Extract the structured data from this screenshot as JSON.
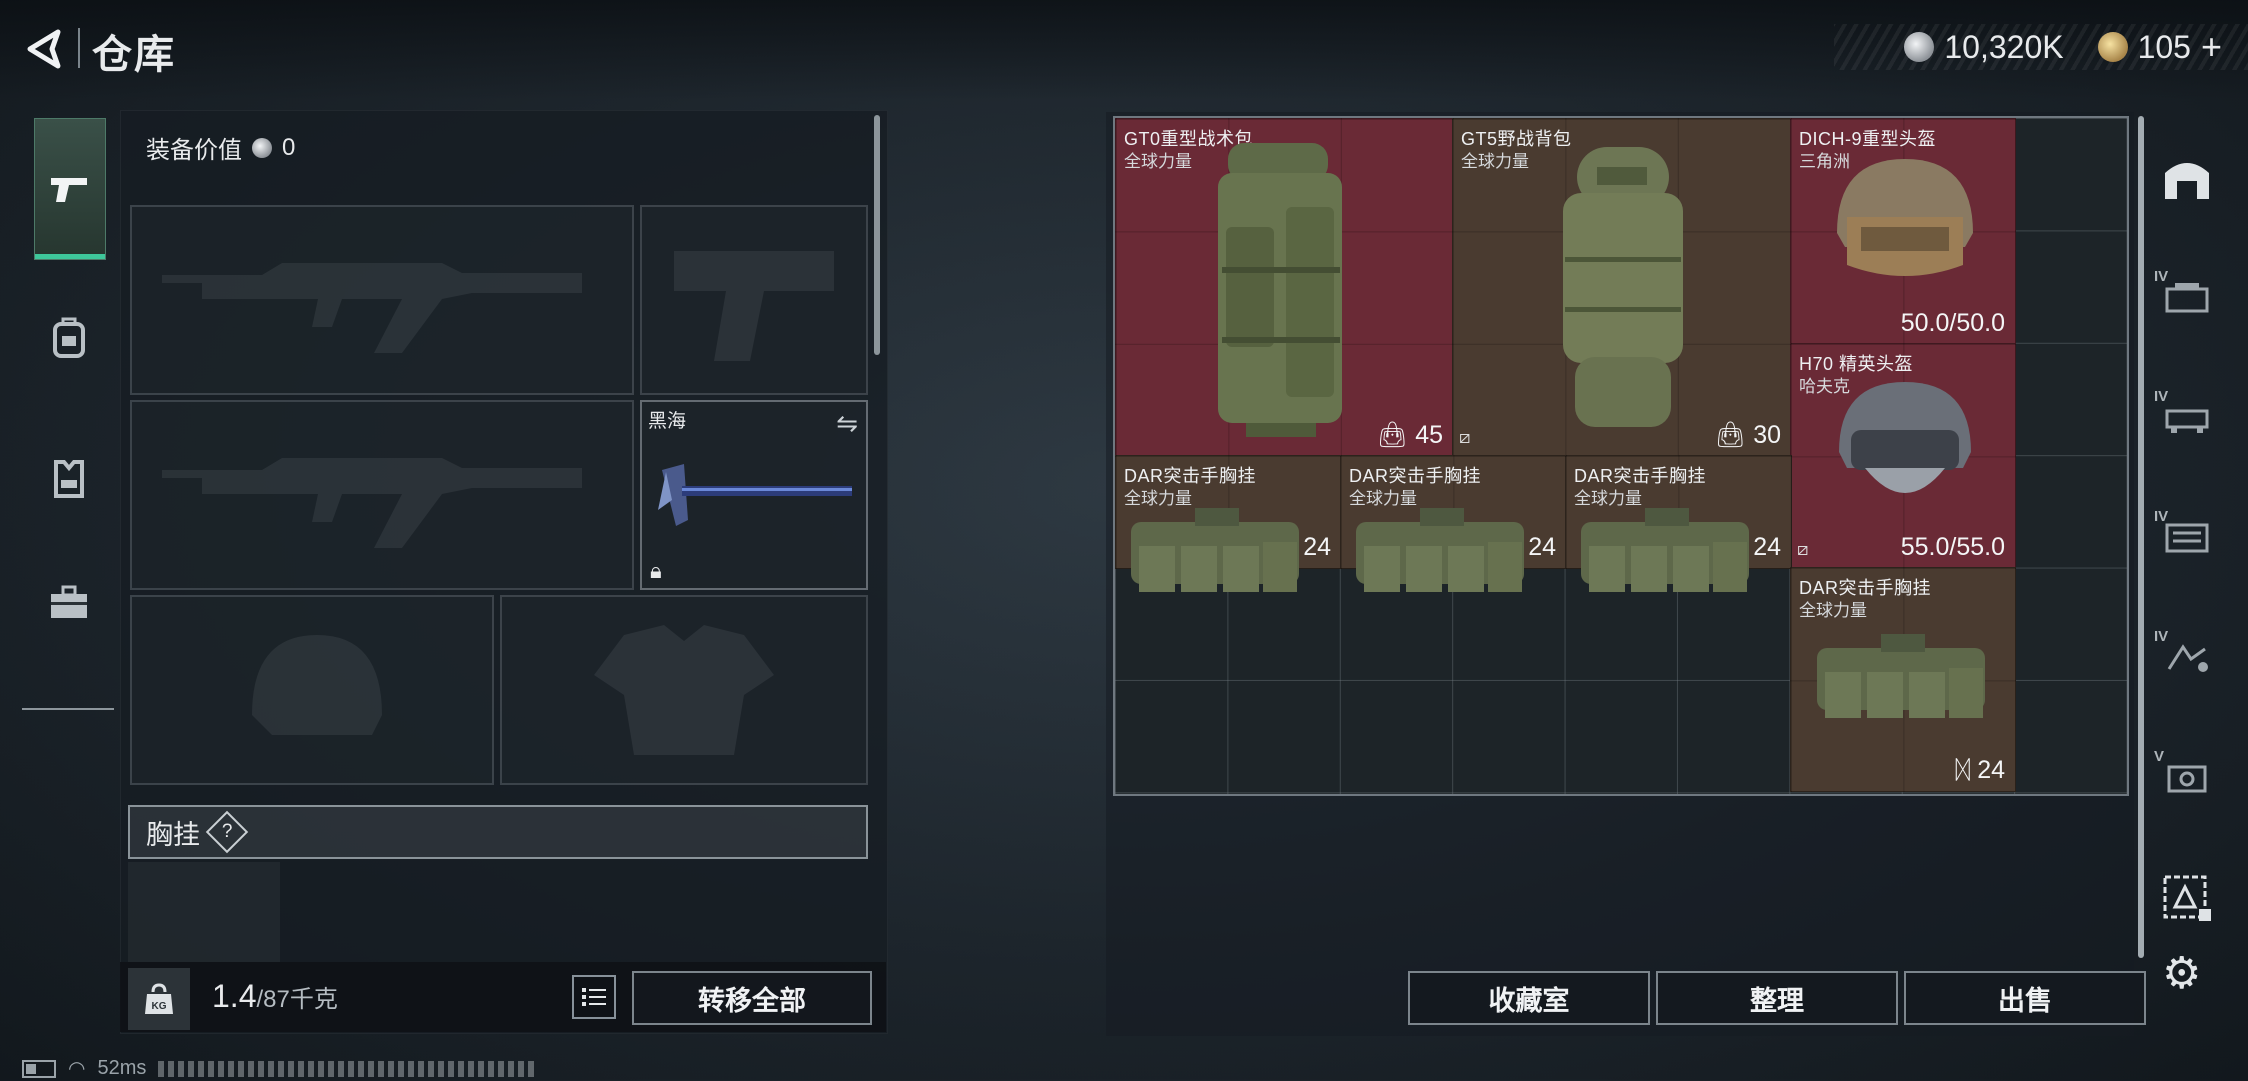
{
  "header": {
    "title": "仓库"
  },
  "currency": {
    "silver": "10,320K",
    "gold": "105",
    "gold_add": "+"
  },
  "left_nav": [
    "pistol-icon",
    "backpack-icon",
    "vest-icon",
    "toolbox-icon"
  ],
  "loadout": {
    "value_label": "装备价值",
    "value": "0",
    "melee_name": "黑海",
    "chest_rig_label": "胸挂",
    "help": "?",
    "weight_current": "1.4",
    "weight_max": "/87千克",
    "transfer_all": "转移全部"
  },
  "stash": {
    "items": [
      {
        "name": "GT0重型战术包",
        "sub": "全球力量",
        "cap": "45",
        "type": "backpack"
      },
      {
        "name": "GT5野战背包",
        "sub": "全球力量",
        "cap": "30",
        "type": "backpack"
      },
      {
        "name": "DICH-9重型头盔",
        "sub": "三角洲",
        "dur": "50.0/50.0",
        "type": "helmet"
      },
      {
        "name": "H70 精英头盔",
        "sub": "哈夫克",
        "dur": "55.0/55.0",
        "type": "helmet"
      },
      {
        "name": "DAR突击手胸挂",
        "sub": "全球力量",
        "cap": "24",
        "type": "rig"
      },
      {
        "name": "DAR突击手胸挂",
        "sub": "全球力量",
        "cap": "24",
        "type": "rig"
      },
      {
        "name": "DAR突击手胸挂",
        "sub": "全球力量",
        "cap": "24",
        "type": "rig"
      },
      {
        "name": "DAR突击手胸挂",
        "sub": "全球力量",
        "cap": "24",
        "type": "rig"
      }
    ]
  },
  "buttons": {
    "collection": "收藏室",
    "organize": "整理",
    "sell": "出售"
  },
  "right_nav": [
    {
      "icon": "stash-home-icon",
      "level": ""
    },
    {
      "icon": "stash-upgrade-1-icon",
      "level": "IV"
    },
    {
      "icon": "stash-upgrade-2-icon",
      "level": "IV"
    },
    {
      "icon": "stash-upgrade-3-icon",
      "level": "IV"
    },
    {
      "icon": "stash-upgrade-4-icon",
      "level": "IV"
    },
    {
      "icon": "stash-upgrade-5-icon",
      "level": "V"
    },
    {
      "icon": "stash-special-icon",
      "level": ""
    }
  ],
  "status": {
    "ping": "52ms"
  },
  "colors": {
    "accent": "#3ec79a",
    "item_red": "#6a2a36",
    "item_brown": "#4a3b30"
  }
}
